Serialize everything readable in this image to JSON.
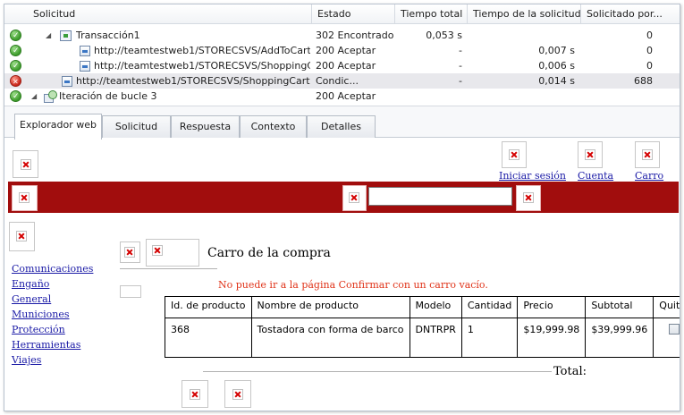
{
  "grid": {
    "columns": [
      "Solicitud",
      "Estado",
      "Tiempo total",
      "Tiempo de la solicitud",
      "Solicitado por..."
    ],
    "rows": [
      {
        "status": "ok",
        "label": "Transacción1",
        "estado": "302 Encontrado",
        "tiempo_total": "0,053 s",
        "tiempo_solicitud": "",
        "solicitado": "0"
      },
      {
        "status": "ok",
        "label": "http://teamtestweb1/STORECSVS/AddToCart...",
        "estado": "200 Aceptar",
        "tiempo_total": "-",
        "tiempo_solicitud": "0,007 s",
        "solicitado": "0"
      },
      {
        "status": "ok",
        "label": "http://teamtestweb1/STORECSVS/ShoppingC...",
        "estado": "200 Aceptar",
        "tiempo_total": "-",
        "tiempo_solicitud": "0,006 s",
        "solicitado": "0"
      },
      {
        "status": "error",
        "label": "http://teamtestweb1/STORECSVS/ShoppingCart...",
        "estado": "Condic...",
        "tiempo_total": "-",
        "tiempo_solicitud": "0,014 s",
        "solicitado": "688"
      },
      {
        "status": "ok",
        "label": "Iteración de bucle 3",
        "estado": "200 Aceptar",
        "tiempo_total": "",
        "tiempo_solicitud": "",
        "solicitado": ""
      }
    ]
  },
  "tabs": [
    "Explorador web",
    "Solicitud",
    "Respuesta",
    "Contexto",
    "Detalles"
  ],
  "browser": {
    "top_links": [
      "Iniciar sesión",
      "Cuenta",
      "Carro"
    ],
    "categories": [
      "Comunicaciones",
      "Engaño",
      "General",
      "Municiones",
      "Protección",
      "Herramientas",
      "Viajes"
    ],
    "cart_title": "Carro de la compra",
    "message": "No puede ir a la página Confirmar con un carro vacío.",
    "table": {
      "headers": [
        "Id. de producto",
        "Nombre de producto",
        "Modelo",
        "Cantidad",
        "Precio",
        "Subtotal",
        "Quitar"
      ],
      "row": [
        "368",
        "Tostadora con forma de barco",
        "DNTRPR",
        "1",
        "$19,999.98",
        "$39,999.96"
      ]
    },
    "total_label": "Total:"
  },
  "colors": {
    "banner": "#a10d0d",
    "link": "#1a1aa6",
    "message": "#e0341a"
  }
}
